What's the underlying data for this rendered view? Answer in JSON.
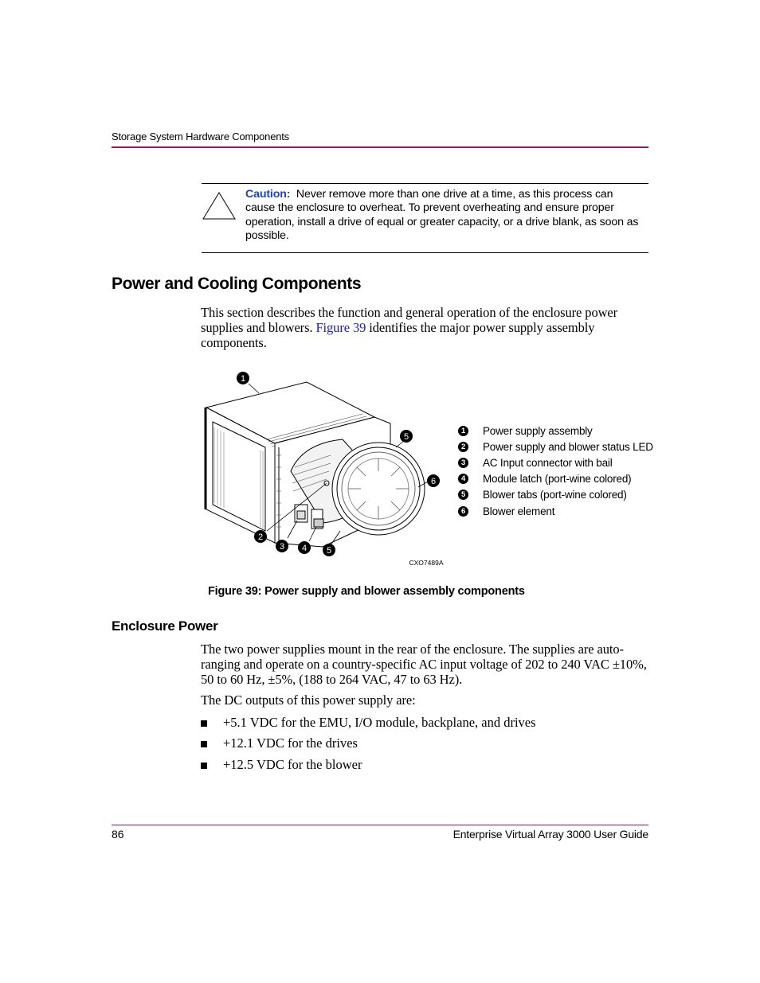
{
  "header": {
    "running_title": "Storage System Hardware Components"
  },
  "caution": {
    "icon": "warning-triangle-icon",
    "label": "Caution:",
    "text": "Never remove more than one drive at a time, as this process can cause the enclosure to overheat. To prevent overheating and ensure proper operation, install a drive of equal or greater capacity, or a drive blank, as soon as possible."
  },
  "section": {
    "heading": "Power and Cooling Components",
    "intro_before_link": "This section describes the function and general operation of the enclosure power supplies and blowers. ",
    "intro_link": "Figure 39",
    "intro_after_link": " identifies the major power supply assembly components."
  },
  "figure": {
    "callouts": [
      "1",
      "2",
      "3",
      "4",
      "5",
      "5",
      "6"
    ],
    "art_id": "CXO7489A",
    "legend": [
      {
        "num": "1",
        "label": "Power supply assembly"
      },
      {
        "num": "2",
        "label": "Power supply and blower status LED"
      },
      {
        "num": "3",
        "label": "AC Input connector with bail"
      },
      {
        "num": "4",
        "label": "Module latch (port-wine colored)"
      },
      {
        "num": "5",
        "label": "Blower tabs (port-wine colored)"
      },
      {
        "num": "6",
        "label": "Blower element"
      }
    ],
    "caption": "Figure 39:  Power supply and blower assembly components"
  },
  "enclosure_power": {
    "heading": "Enclosure Power",
    "paragraph": "The two power supplies mount in the rear of the enclosure. The supplies are auto-ranging and operate on a country-specific AC input voltage of 202 to 240 VAC ±10%, 50 to 60 Hz, ±5%, (188 to 264 VAC, 47 to 63 Hz).",
    "dc_intro": "The DC outputs of this power supply are:",
    "bullets": [
      "+5.1 VDC for the EMU, I/O module, backplane, and drives",
      "+12.1 VDC for the drives",
      "+12.5 VDC for the blower"
    ]
  },
  "footer": {
    "page_number": "86",
    "document_title": "Enterprise Virtual Array 3000 User Guide"
  },
  "colors": {
    "rule_accent": "#9b1a5e",
    "caution_label": "#1a3fd1",
    "link": "#1a1ae0"
  }
}
